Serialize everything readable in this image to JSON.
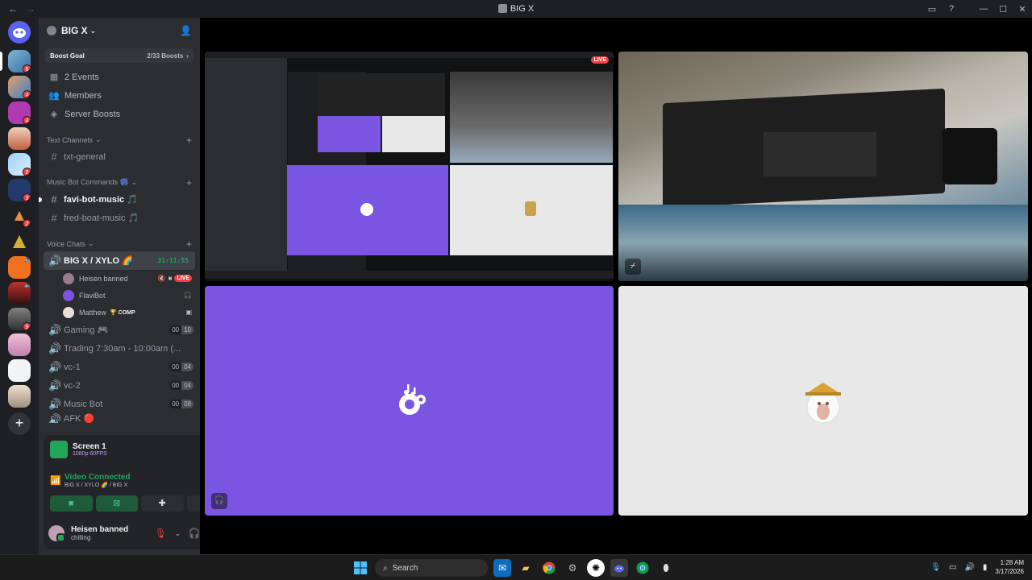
{
  "window": {
    "title": "BIG X"
  },
  "guild": {
    "name": "BIG X",
    "boost_label": "Boost Goal",
    "boost_progress": "2/33 Boosts",
    "shortcuts": [
      {
        "label": "2 Events",
        "icon": "calendar-icon"
      },
      {
        "label": "Members",
        "icon": "members-icon"
      },
      {
        "label": "Server Boosts",
        "icon": "boost-icon"
      }
    ]
  },
  "categories": {
    "text": "Text Channels",
    "music": "Music Bot Commands 🎆",
    "voice": "Voice Chats"
  },
  "text_channels": [
    {
      "name": "txt-general"
    }
  ],
  "music_channels": [
    {
      "name": "favi-bot-music 🎵"
    },
    {
      "name": "fred-boat-music 🎵"
    }
  ],
  "active_voice": {
    "name": "BIG X / XYLO 🌈",
    "timer": "31:11:55",
    "members": [
      {
        "name": "Heisen banned",
        "live": "LIVE"
      },
      {
        "name": "FlaviBot"
      },
      {
        "name": "Matthew",
        "badge": "🏆 COMP"
      }
    ]
  },
  "voice_channels": [
    {
      "name": "Gaming 🎮",
      "a": "00",
      "b": "10"
    },
    {
      "name": "Trading 7:30am - 10:00am (...",
      "a": "",
      "b": ""
    },
    {
      "name": "vc-1",
      "a": "00",
      "b": "04"
    },
    {
      "name": "vc-2",
      "a": "00",
      "b": "04"
    },
    {
      "name": "Music Bot",
      "a": "00",
      "b": "08"
    },
    {
      "name": "AFK 🔴",
      "a": "",
      "b": ""
    }
  ],
  "panel": {
    "screen_title": "Screen 1",
    "screen_quality": "1080p 60FPS",
    "vc_status": "Video Connected",
    "vc_location": "BIG X / XYLO 🌈 / BIG X",
    "user_name": "Heisen banned",
    "user_status": "chilling"
  },
  "stage": {
    "live_label": "LIVE"
  },
  "taskbar": {
    "search": "Search",
    "time": "1:28 AM",
    "date": "3/17/2026"
  },
  "colors": {
    "accent_green": "#23a55a",
    "live_red": "#f23f43",
    "tile_purple": "#7a55e2"
  }
}
